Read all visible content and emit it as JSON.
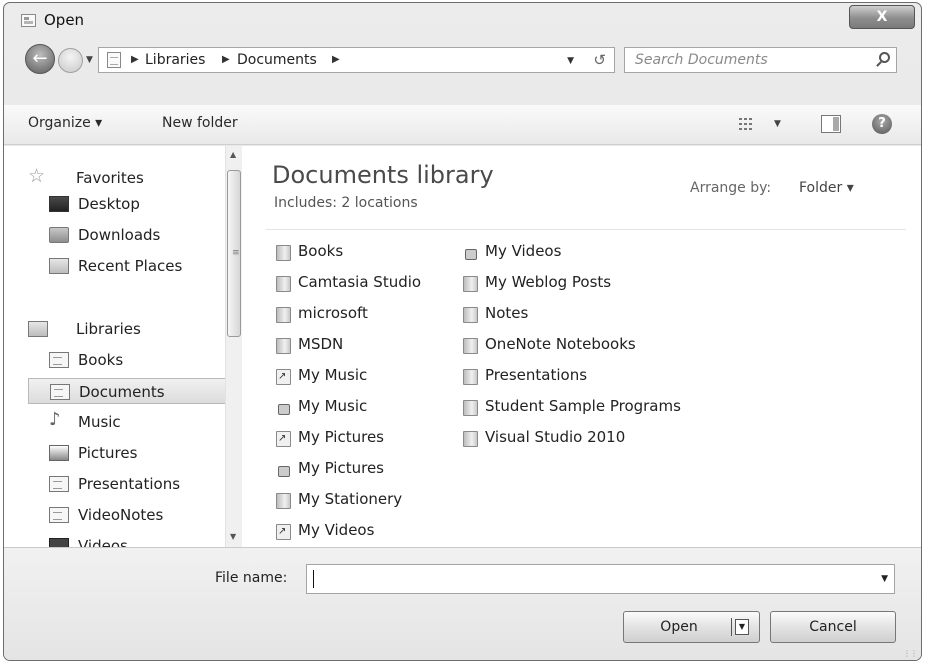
{
  "window": {
    "title": "Open",
    "close_label": "X"
  },
  "nav": {
    "breadcrumbs": [
      "Libraries",
      "Documents"
    ],
    "search_placeholder": "Search Documents"
  },
  "toolbar": {
    "organize": "Organize ▾",
    "new_folder": "New folder"
  },
  "sidebar": {
    "favorites": {
      "label": "Favorites",
      "items": [
        "Desktop",
        "Downloads",
        "Recent Places"
      ]
    },
    "libraries": {
      "label": "Libraries",
      "items": [
        "Books",
        "Documents",
        "Music",
        "Pictures",
        "Presentations",
        "VideoNotes",
        "Videos"
      ],
      "selected": "Documents"
    }
  },
  "library": {
    "title": "Documents library",
    "subtitle": "Includes:  2 locations",
    "arrange_label": "Arrange by:",
    "arrange_value": "Folder ▾"
  },
  "files": {
    "col1": [
      {
        "name": "Books",
        "icon": "folder-icon"
      },
      {
        "name": "Camtasia Studio",
        "icon": "folder-icon"
      },
      {
        "name": "microsoft",
        "icon": "folder-icon"
      },
      {
        "name": "MSDN",
        "icon": "folder-icon"
      },
      {
        "name": "My Music",
        "icon": "shortcut-icon"
      },
      {
        "name": "My Music",
        "icon": "placeholder-icon"
      },
      {
        "name": "My Pictures",
        "icon": "shortcut-icon"
      },
      {
        "name": "My Pictures",
        "icon": "placeholder-icon"
      },
      {
        "name": "My Stationery",
        "icon": "folder-icon"
      },
      {
        "name": "My Videos",
        "icon": "shortcut-icon"
      }
    ],
    "col2": [
      {
        "name": "My Videos",
        "icon": "placeholder-icon"
      },
      {
        "name": "My Weblog Posts",
        "icon": "folder-icon"
      },
      {
        "name": "Notes",
        "icon": "folder-icon"
      },
      {
        "name": "OneNote Notebooks",
        "icon": "folder-icon"
      },
      {
        "name": "Presentations",
        "icon": "folder-icon"
      },
      {
        "name": "Student Sample Programs",
        "icon": "folder-icon"
      },
      {
        "name": "Visual Studio 2010",
        "icon": "folder-icon"
      }
    ]
  },
  "footer": {
    "file_name_label": "File name:",
    "file_name_value": "",
    "open_label": "Open",
    "cancel_label": "Cancel"
  }
}
